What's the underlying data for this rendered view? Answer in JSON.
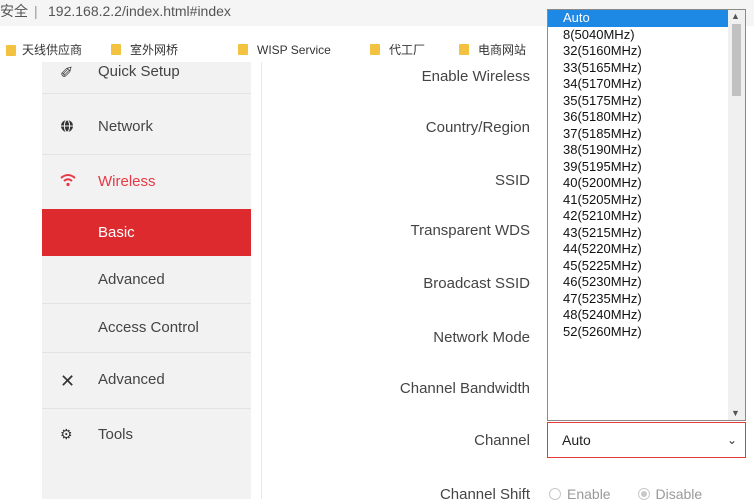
{
  "browser": {
    "secure_label": "安全",
    "separator": "|",
    "url": "192.168.2.2/index.html#index"
  },
  "bookmarks": [
    {
      "label": "天线供应商"
    },
    {
      "label": "室外网桥"
    },
    {
      "label": "WISP Service"
    },
    {
      "label": "代工厂"
    },
    {
      "label": "电商网站"
    }
  ],
  "sidebar": {
    "items": [
      {
        "label": "Quick Setup",
        "icon": "magic-wand-icon"
      },
      {
        "label": "Network",
        "icon": "globe-icon"
      },
      {
        "label": "Wireless",
        "icon": "wifi-icon"
      },
      {
        "label": "Advanced",
        "icon": "tools-icon"
      },
      {
        "label": "Tools",
        "icon": "gears-icon"
      }
    ],
    "wireless_sub": [
      {
        "label": "Basic"
      },
      {
        "label": "Advanced"
      },
      {
        "label": "Access Control"
      }
    ]
  },
  "form": {
    "labels": {
      "enable_wireless": "Enable Wireless",
      "country": "Country/Region",
      "ssid": "SSID",
      "transparent_wds": "Transparent WDS",
      "broadcast_ssid": "Broadcast SSID",
      "network_mode": "Network Mode",
      "channel_bandwidth": "Channel Bandwidth",
      "channel": "Channel",
      "channel_shift": "Channel Shift"
    },
    "channel_value": "Auto",
    "channel_shift_enable": "Enable",
    "channel_shift_disable": "Disable",
    "channel_shift_selected": "Disable"
  },
  "channel_options": [
    "Auto",
    "8(5040MHz)",
    "32(5160MHz)",
    "33(5165MHz)",
    "34(5170MHz)",
    "35(5175MHz)",
    "36(5180MHz)",
    "37(5185MHz)",
    "38(5190MHz)",
    "39(5195MHz)",
    "40(5200MHz)",
    "41(5205MHz)",
    "42(5210MHz)",
    "43(5215MHz)",
    "44(5220MHz)",
    "45(5225MHz)",
    "46(5230MHz)",
    "47(5235MHz)",
    "48(5240MHz)",
    "52(5260MHz)"
  ],
  "colors": {
    "accent": "#dd2a2f",
    "highlight": "#1e88e5"
  }
}
